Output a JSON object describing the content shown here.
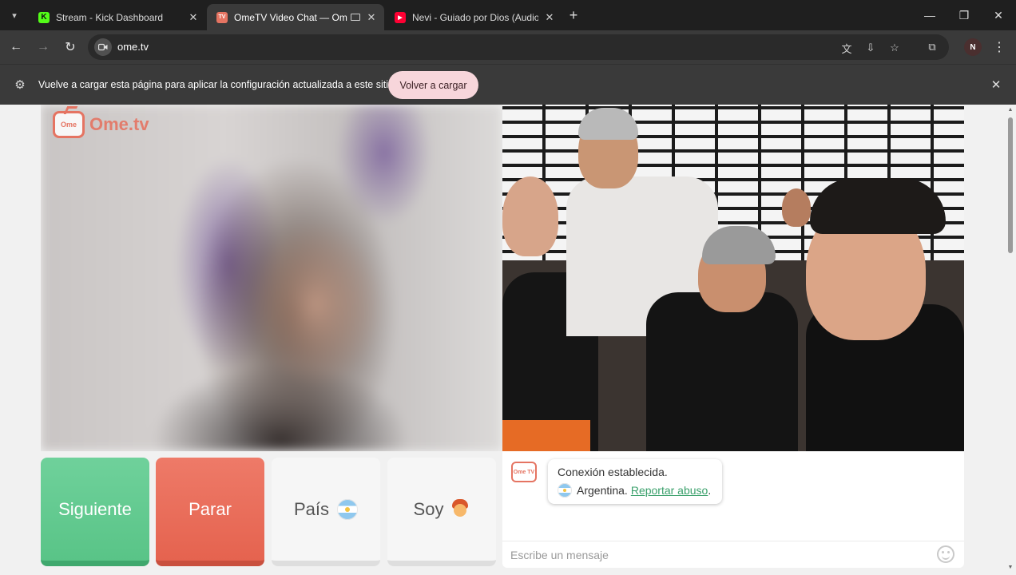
{
  "browser": {
    "tabs": [
      {
        "title": "Stream - Kick Dashboard",
        "favicon": "kick-icon",
        "active": false
      },
      {
        "title": "OmeTV Video Chat — Ome",
        "favicon": "ometv-icon",
        "active": true
      },
      {
        "title": "Nevi - Guiado por Dios (Audio",
        "favicon": "youtube-icon",
        "active": false
      }
    ],
    "url": "ome.tv",
    "profile_initial": "N",
    "infobar": {
      "message": "Vuelve a cargar esta página para aplicar la configuración actualizada a este sitio",
      "button": "Volver a cargar"
    }
  },
  "app": {
    "logo_text": "Ome.tv",
    "logo_badge": "Ome TV",
    "controls": {
      "next": "Siguiente",
      "stop": "Parar",
      "country": "País",
      "gender": "Soy"
    },
    "chat": {
      "status": "Conexión establecida.",
      "country": "Argentina.",
      "report_link": "Reportar abuso",
      "report_suffix": ".",
      "input_placeholder": "Escribe un mensaje"
    }
  },
  "colors": {
    "next_button": "#59c487",
    "stop_button": "#e5634f",
    "brand": "#e57462",
    "link": "#3aa06b"
  }
}
